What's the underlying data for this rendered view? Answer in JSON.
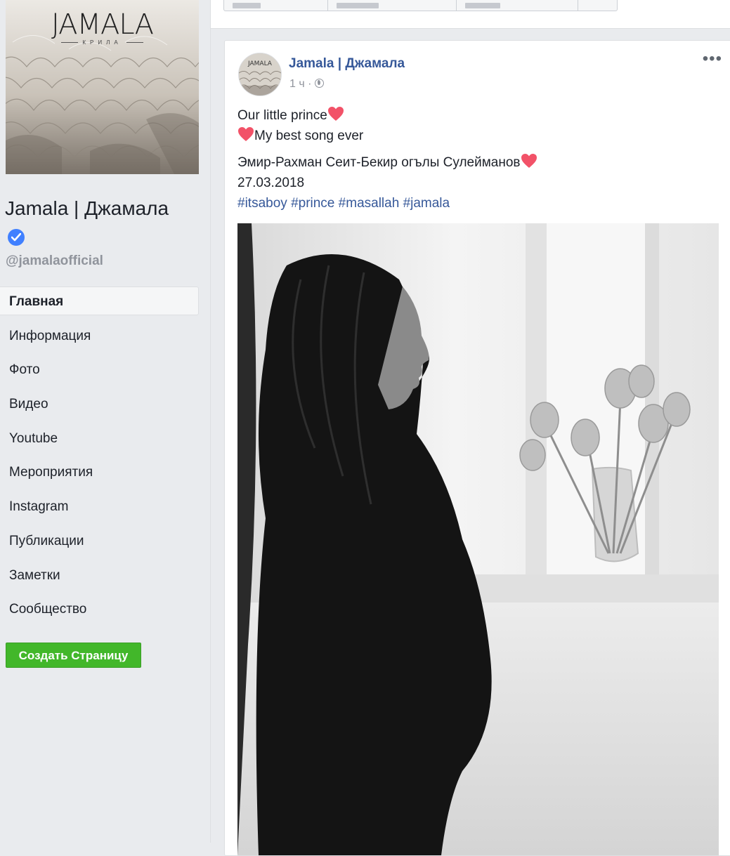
{
  "cover": {
    "logo": "JAMALA",
    "logo_sub": "КРИЛА"
  },
  "page": {
    "name": "Jamala | Джамала",
    "handle": "@jamalaofficial"
  },
  "nav": {
    "items": [
      {
        "label": "Главная",
        "active": true
      },
      {
        "label": "Информация"
      },
      {
        "label": "Фото"
      },
      {
        "label": "Видео"
      },
      {
        "label": "Youtube"
      },
      {
        "label": "Мероприятия"
      },
      {
        "label": "Instagram"
      },
      {
        "label": "Публикации"
      },
      {
        "label": "Заметки"
      },
      {
        "label": "Сообщество"
      }
    ],
    "create_button": "Создать Страницу"
  },
  "post": {
    "author": "Jamala | Джамала",
    "time": "1 ч",
    "separator": "·",
    "line1": "Our little prince",
    "line2": "My best song ever",
    "line3": "Эмир-Рахман Сеит-Бекир огълы Сулейманов",
    "date": "27.03.2018",
    "hashtags": [
      "#itsaboy",
      "#prince",
      "#masallah",
      "#jamala"
    ]
  },
  "colors": {
    "link": "#365899",
    "green_button": "#42b72a",
    "heart": "#f25268",
    "verified": "#4080ff",
    "background": "#e9ebee"
  },
  "icons": {
    "verified": "verified-badge-icon",
    "globe": "globe-icon",
    "more": "more-options-icon",
    "heart": "heart-emoji-icon"
  }
}
